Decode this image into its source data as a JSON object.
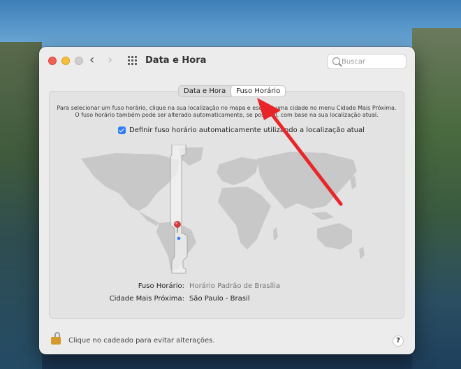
{
  "window": {
    "title": "Data e Hora",
    "search_placeholder": "Buscar"
  },
  "nav": {
    "back_glyph": "‹",
    "forward_glyph": "›"
  },
  "tabs": [
    {
      "label": "Data e Hora",
      "selected": false
    },
    {
      "label": "Fuso Horário",
      "selected": true
    }
  ],
  "instructions": {
    "line1": "Para selecionar um fuso horário, clique na sua localização no mapa e escolha uma cidade no menu Cidade Mais Próxima.",
    "line2": "O fuso horário também pode ser alterado automaticamente, se possível, com base na sua localização atual."
  },
  "auto_timezone": {
    "label": "Definir fuso horário automaticamente utilizando a localização atual",
    "checked": true
  },
  "timezone": {
    "label": "Fuso Horário:",
    "value": "Horário Padrão de Brasília"
  },
  "closest_city": {
    "label": "Cidade Mais Próxima:",
    "value": "São Paulo - Brasil"
  },
  "footer": {
    "lock_text": "Clique no cadeado para evitar alterações.",
    "help_glyph": "?"
  },
  "colors": {
    "accent": "#2f7cf6",
    "annotation_arrow": "#e8262a",
    "map_land": "#c8c8c8",
    "pin": "#d93b3b"
  },
  "icons": [
    "search-icon",
    "grid-icon",
    "lock-icon",
    "help-icon",
    "location-pin-icon"
  ]
}
